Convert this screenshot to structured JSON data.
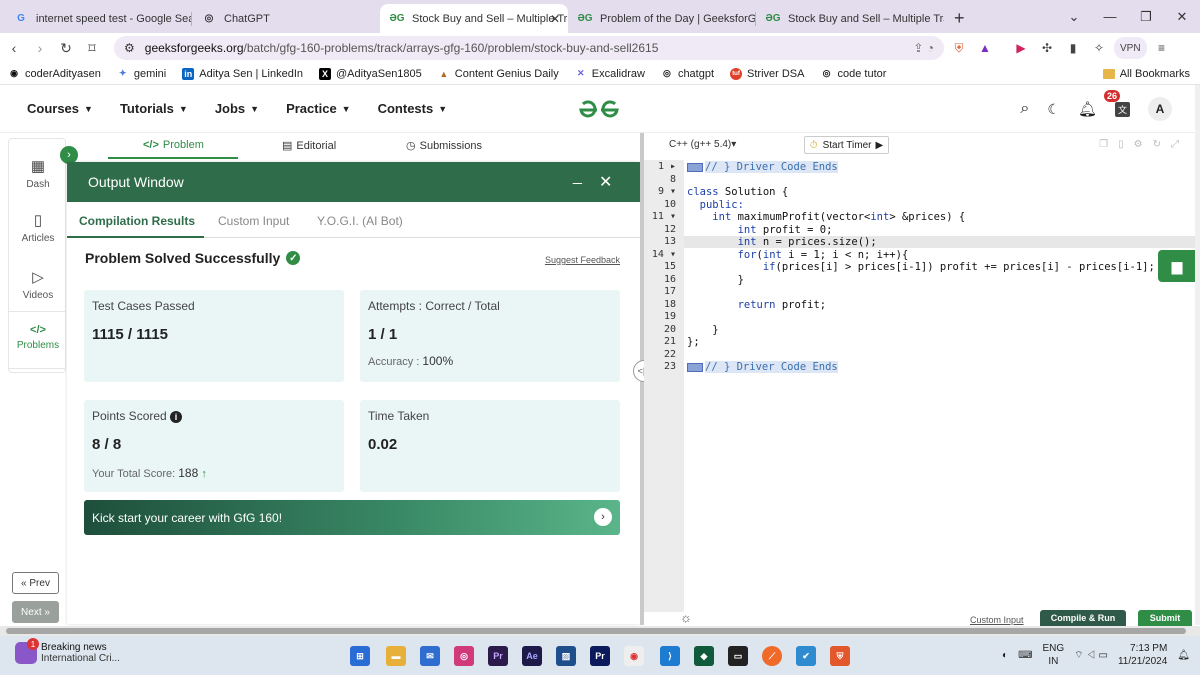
{
  "browser": {
    "tabs": [
      {
        "title": "internet speed test - Google Search",
        "icon": "G",
        "icon_color": "#4285f4",
        "active": false
      },
      {
        "title": "ChatGPT",
        "icon": "◎",
        "icon_color": "#333333",
        "active": false
      },
      {
        "title": "Stock Buy and Sell – Multiple Tr",
        "icon": "GG",
        "icon_color": "#2f8d46",
        "active": true
      },
      {
        "title": "Problem of the Day | GeeksforGeeks",
        "icon": "GG",
        "icon_color": "#2f8d46",
        "active": false
      },
      {
        "title": "Stock Buy and Sell – Multiple Transa",
        "icon": "GG",
        "icon_color": "#2f8d46",
        "active": false
      }
    ],
    "new_tab": "+",
    "url_host": "geeksforgeeks.org",
    "url_path": "/batch/gfg-160-problems/track/arrays-gfg-160/problem/stock-buy-and-sell2615",
    "vpn_label": "VPN",
    "bookmarks": [
      {
        "label": "coderAdityasen",
        "icon": "◉",
        "color": "#111111"
      },
      {
        "label": "gemini",
        "icon": "✦",
        "color": "#4a7bdc"
      },
      {
        "label": "Aditya Sen | LinkedIn",
        "icon": "in",
        "color": "#0a66c2"
      },
      {
        "label": "@AdityaSen1805",
        "icon": "X",
        "color": "#000000"
      },
      {
        "label": "Content Genius Daily",
        "icon": "▲",
        "color": "#b06a2a"
      },
      {
        "label": "Excalidraw",
        "icon": "✕",
        "color": "#6965db"
      },
      {
        "label": "chatgpt",
        "icon": "◎",
        "color": "#333333"
      },
      {
        "label": "Striver DSA",
        "icon": "tuf",
        "color": "#e0402a"
      },
      {
        "label": "code tutor",
        "icon": "◎",
        "color": "#333333"
      }
    ],
    "all_bookmarks": "All Bookmarks"
  },
  "site": {
    "menus": [
      "Courses",
      "Tutorials",
      "Jobs",
      "Practice",
      "Contests"
    ],
    "notification_count": "26",
    "avatar_letter": "A",
    "brand_color": "#2f8d46"
  },
  "rail": {
    "items": [
      {
        "label": "Dash",
        "icon": "▦"
      },
      {
        "label": "Articles",
        "icon": "▯▯"
      },
      {
        "label": "Videos",
        "icon": "▷"
      },
      {
        "label": "Problems",
        "icon": "</>"
      }
    ],
    "prev": "« Prev",
    "next": "Next »"
  },
  "problem_tabs": [
    {
      "label": "Problem",
      "icon": "</>"
    },
    {
      "label": "Editorial",
      "icon": "▤"
    },
    {
      "label": "Submissions",
      "icon": "◷"
    }
  ],
  "output": {
    "title": "Output Window",
    "tabs": [
      "Compilation Results",
      "Custom Input",
      "Y.O.G.I. (AI Bot)"
    ],
    "status": "Problem Solved Successfully",
    "feedback": "Suggest Feedback",
    "cards": {
      "tests_label": "Test Cases Passed",
      "tests_value": "1115 / 1115",
      "attempts_label": "Attempts : Correct / Total",
      "attempts_value": "1 / 1",
      "accuracy_label": "Accuracy :",
      "accuracy_value": "100%",
      "points_label": "Points Scored",
      "points_value": "8 / 8",
      "total_label": "Your Total Score:",
      "total_value": "188",
      "time_label": "Time Taken",
      "time_value": "0.02"
    },
    "banner": "Kick start your career with GfG 160!"
  },
  "editor": {
    "language": "C++ (g++ 5.4)",
    "timer": "Start Timer",
    "line_numbers": [
      "1",
      "8",
      "9",
      "10",
      "11",
      "12",
      "13",
      "14",
      "15",
      "16",
      "17",
      "18",
      "19",
      "20",
      "21",
      "22",
      "23"
    ],
    "fold_markers": [
      "▸",
      "",
      "▾",
      "",
      "▾",
      "",
      "",
      "▾",
      "",
      "",
      "",
      "",
      "",
      "",
      "",
      "",
      ""
    ],
    "lines": [
      "// } Driver Code Ends",
      "",
      "class Solution {",
      "  public:",
      "    int maximumProfit(vector<int> &prices) {",
      "        int profit = 0;",
      "        int n = prices.size();",
      "        for(int i = 1; i < n; i++){",
      "            if(prices[i] > prices[i-1]) profit += prices[i] - prices[i-1];",
      "        }",
      "",
      "        return profit;",
      "",
      "    }",
      "};",
      "",
      "// } Driver Code Ends"
    ],
    "custom_input": "Custom Input",
    "compile": "Compile & Run",
    "submit": "Submit"
  },
  "taskbar": {
    "news_title": "Breaking news",
    "news_sub": "International Cri...",
    "news_badge": "1",
    "lang1": "ENG",
    "lang2": "IN",
    "time": "7:13 PM",
    "date": "11/21/2024"
  }
}
